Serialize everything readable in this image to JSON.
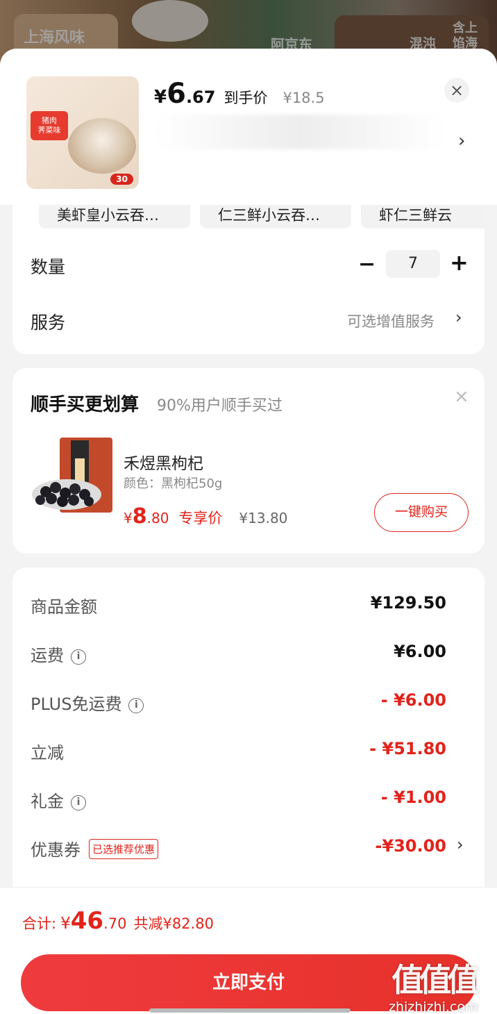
{
  "background": {
    "text_left": "上海风味",
    "text_mid": "阿京东",
    "text_right": "含上\n馅海",
    "text_right2": "混沌"
  },
  "product": {
    "price_currency": "¥",
    "price_int": "6",
    "price_dec": ".67",
    "price_label": "到手价",
    "original_price": "¥18.5",
    "thumb_tag": "猪肉\n荠菜味",
    "thumb_badge": "30"
  },
  "options": {
    "chips": [
      "美虾皇小云吞…",
      "仁三鲜小云吞…",
      "虾仁三鲜云"
    ],
    "quantity_label": "数量",
    "quantity_value": "7",
    "minus_symbol": "−",
    "plus_symbol": "+",
    "service_label": "服务",
    "service_value": "可选增值服务"
  },
  "addon": {
    "title": "顺手买更划算",
    "subtitle": "90%用户顺手买过",
    "name": "禾煜黑枸杞",
    "variant": "颜色：黑枸杞50g",
    "price_currency": "¥",
    "price_int": "8",
    "price_dec": ".80",
    "price_label": "专享价",
    "original_price": "¥13.80",
    "buy_label": "一键购买"
  },
  "summary": {
    "rows": [
      {
        "label": "商品金额",
        "value": "¥129.50"
      },
      {
        "label": "运费",
        "value": "¥6.00"
      },
      {
        "label": "PLUS免运费",
        "value": "- ¥6.00"
      },
      {
        "label": "立减",
        "value": "- ¥51.80"
      },
      {
        "label": "礼金",
        "value": "- ¥1.00"
      },
      {
        "label": "优惠券",
        "value": "-¥30.00",
        "tag": "已选推荐优惠"
      }
    ]
  },
  "footer": {
    "total_label": "合计:",
    "total_currency": "¥",
    "total_int": "46",
    "total_dec": ".70",
    "saved_text": "共减¥82.80",
    "pay_label": "立即支付"
  },
  "watermark": {
    "logo": "值值值",
    "site": "zhizhizhi.com"
  },
  "colors": {
    "accent_red": "#e2231a",
    "pay_button": "#ef3b3e"
  },
  "icons": [
    "close-icon",
    "chevron-right-icon",
    "info-icon",
    "minus-icon",
    "plus-icon"
  ]
}
